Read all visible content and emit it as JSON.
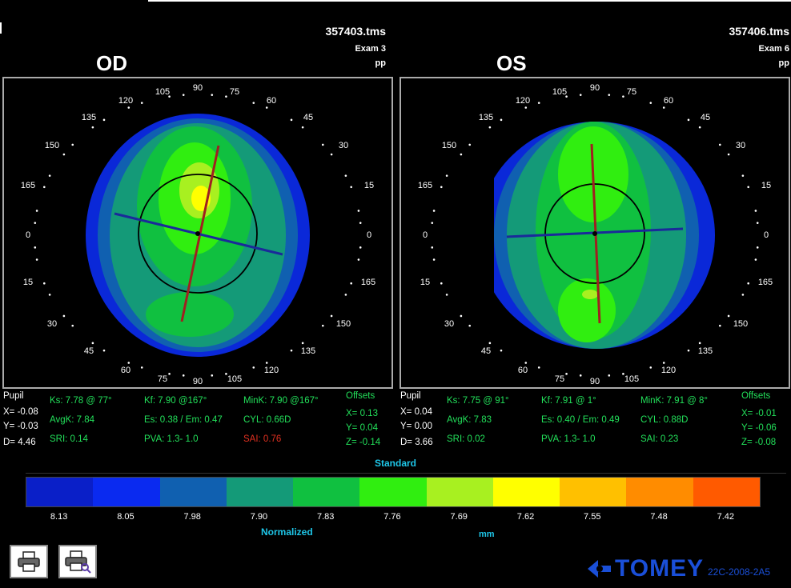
{
  "od": {
    "file": "357403.tms",
    "exam": "Exam 3",
    "mode": "pp",
    "label": "OD",
    "pupil": {
      "title": "Pupil",
      "x": "X= -0.08",
      "y": "Y= -0.03",
      "d": "D= 4.46"
    },
    "ks": "Ks: 7.78 @ 77°",
    "avgk": "AvgK: 7.84",
    "sri": "SRI: 0.14",
    "kf": "Kf: 7.90 @167°",
    "es": "Es: 0.38 / Em: 0.47",
    "pva": "PVA:  1.3-  1.0",
    "mink": "MinK: 7.90 @167°",
    "cyl": "CYL: 0.66D",
    "sai": "SAI: 0.76",
    "offsets": {
      "title": "Offsets",
      "x": "X= 0.13",
      "y": "Y= 0.04",
      "z": "Z= -0.14"
    }
  },
  "os": {
    "file": "357406.tms",
    "exam": "Exam 6",
    "mode": "pp",
    "label": "OS",
    "pupil": {
      "title": "Pupil",
      "x": "X= 0.04",
      "y": "Y= 0.00",
      "d": "D= 3.66"
    },
    "ks": "Ks: 7.75 @ 91°",
    "avgk": "AvgK: 7.83",
    "sri": "SRI: 0.02",
    "kf": "Kf: 7.91 @  1°",
    "es": "Es: 0.40 / Em: 0.49",
    "pva": "PVA:  1.3-  1.0",
    "mink": "MinK: 7.91 @  8°",
    "cyl": "CYL: 0.88D",
    "sai": "SAI: 0.23",
    "offsets": {
      "title": "Offsets",
      "x": "X= -0.01",
      "y": "Y= -0.06",
      "z": "Z= -0.08"
    }
  },
  "angle_labels": [
    "0",
    "15",
    "30",
    "45",
    "60",
    "75",
    "90",
    "105",
    "120",
    "135",
    "150",
    "165",
    "0",
    "15",
    "30",
    "45",
    "60",
    "75",
    "90",
    "105",
    "120",
    "135",
    "150",
    "165"
  ],
  "scale": {
    "title": "Standard",
    "subtitle": "Normalized",
    "unit": "mm",
    "values": [
      "8.13",
      "8.05",
      "7.98",
      "7.90",
      "7.83",
      "7.76",
      "7.69",
      "7.62",
      "7.55",
      "7.48",
      "7.42"
    ],
    "colors": [
      "#0a1fc8",
      "#0a2af0",
      "#1060b0",
      "#149a78",
      "#10c040",
      "#30ee10",
      "#a8f020",
      "#ffff00",
      "#ffc000",
      "#ff8c00",
      "#ff5a00"
    ]
  },
  "toolbar": {
    "print_icon": "printer-icon",
    "print_preview_icon": "print-preview-icon"
  },
  "brand": {
    "logo": "TOMEY",
    "model": "22C-2008-2A5"
  }
}
